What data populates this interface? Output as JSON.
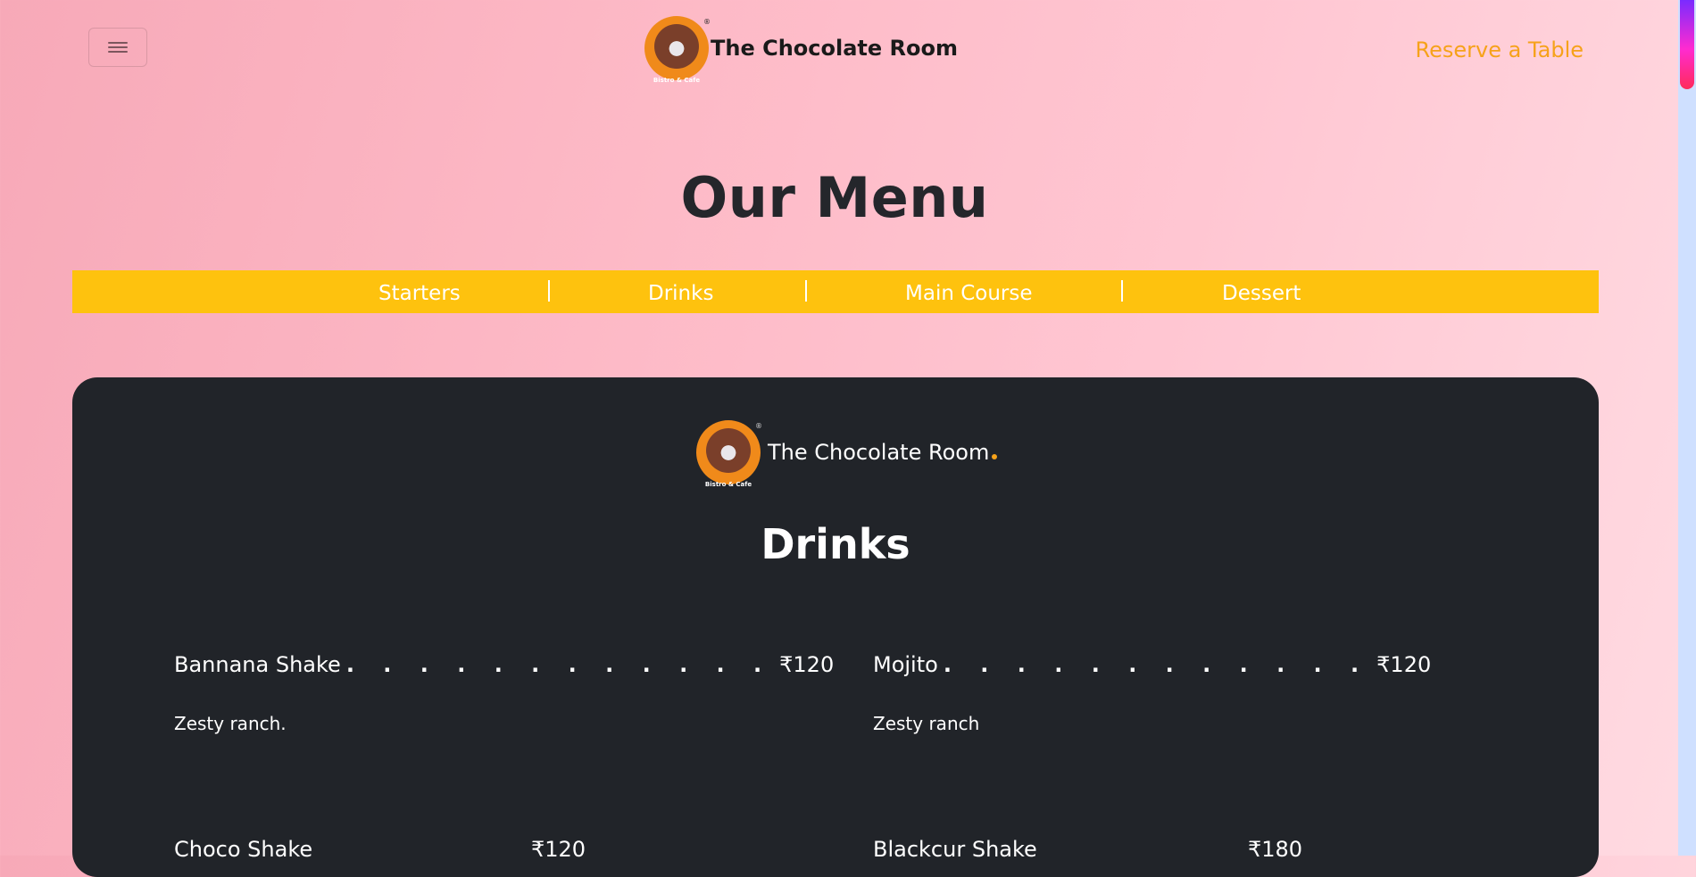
{
  "navbar": {
    "brand_name": "The Chocolate Room",
    "reserve_label": "Reserve a Table",
    "logo_sub_text": "Bistro & Cafe",
    "logo_reg": "®"
  },
  "page": {
    "title": "Our Menu"
  },
  "tabs": [
    {
      "label": "Starters"
    },
    {
      "label": "Drinks"
    },
    {
      "label": "Main Course"
    },
    {
      "label": "Dessert"
    }
  ],
  "card": {
    "brand_name": "The Chocolate Room",
    "section_title": "Drinks",
    "items": [
      {
        "name": "Bannana Shake",
        "dots": ". . . . . . . . . . . .",
        "price": "₹120",
        "desc": "Zesty ranch."
      },
      {
        "name": "Mojito",
        "dots": ". . . . . . . . . . . .",
        "price": "₹120",
        "desc": "Zesty ranch"
      },
      {
        "name": "Choco Shake",
        "dots": "",
        "price": "₹120",
        "desc": ""
      },
      {
        "name": "Blackcur Shake",
        "dots": "",
        "price": "₹180",
        "desc": ""
      }
    ]
  },
  "colors": {
    "accent": "#f6a21a",
    "tab_bar": "#fec20e",
    "card_bg": "#212429"
  }
}
